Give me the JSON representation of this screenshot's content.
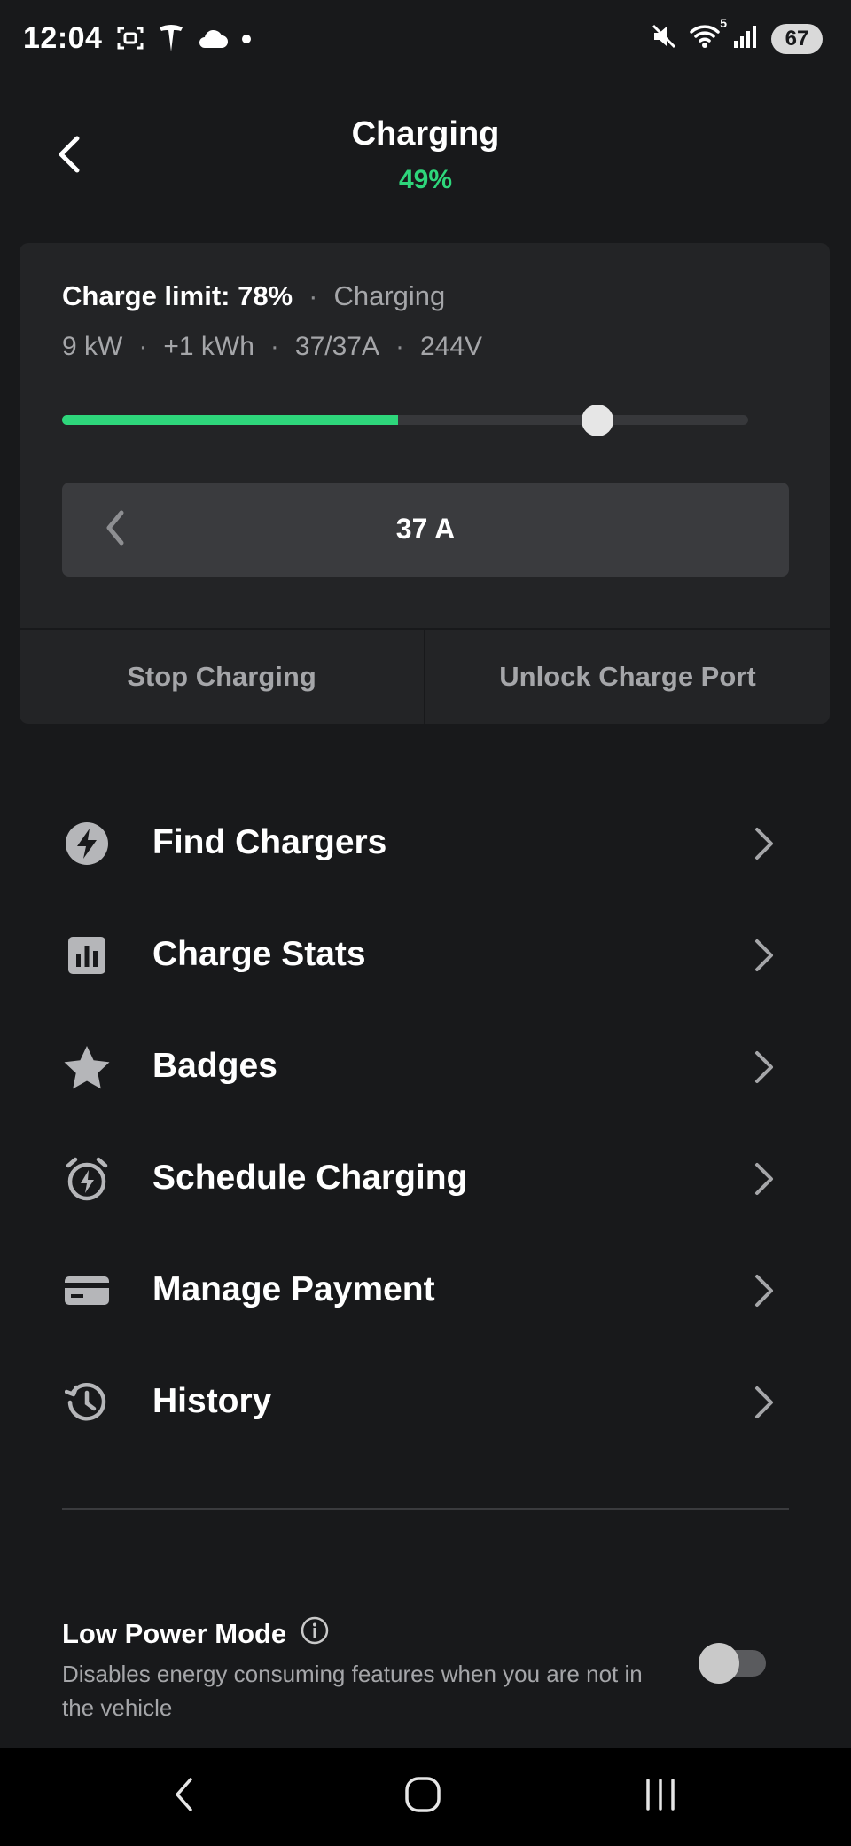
{
  "status_bar": {
    "time": "12:04",
    "battery": "67",
    "wifi_badge": "5",
    "left_icons": [
      "screenshot-icon",
      "tesla-icon",
      "cloud-icon",
      "dot-icon"
    ],
    "right_icons": [
      "mute-icon",
      "wifi-icon",
      "signal-icon",
      "battery-icon"
    ]
  },
  "header": {
    "title": "Charging",
    "subtitle": "49%",
    "back_icon": "chevron-left-icon"
  },
  "charge_card": {
    "limit_text": "Charge limit: 78%",
    "state_text": "Charging",
    "stats": [
      "9 kW",
      "+1 kWh",
      "37/37A",
      "244V"
    ],
    "separator": "·",
    "current_level_fraction": 0.49,
    "limit_fraction": 0.78,
    "amperage": "37 A",
    "stop_label": "Stop Charging",
    "unlock_label": "Unlock Charge Port"
  },
  "menu": {
    "items": [
      {
        "label": "Find Chargers",
        "icon": "lightning-bolt-icon"
      },
      {
        "label": "Charge Stats",
        "icon": "bar-chart-icon"
      },
      {
        "label": "Badges",
        "icon": "star-icon"
      },
      {
        "label": "Schedule Charging",
        "icon": "alarm-clock-icon"
      },
      {
        "label": "Manage Payment",
        "icon": "credit-card-icon"
      },
      {
        "label": "History",
        "icon": "history-icon"
      }
    ]
  },
  "low_power": {
    "title": "Low Power Mode",
    "description": "Disables energy consuming features when you are not in the vehicle",
    "enabled": false
  },
  "colors": {
    "background": "#18191b",
    "card": "#232426",
    "accent_green": "#2ed67b",
    "muted_text": "#a5a6a9"
  }
}
